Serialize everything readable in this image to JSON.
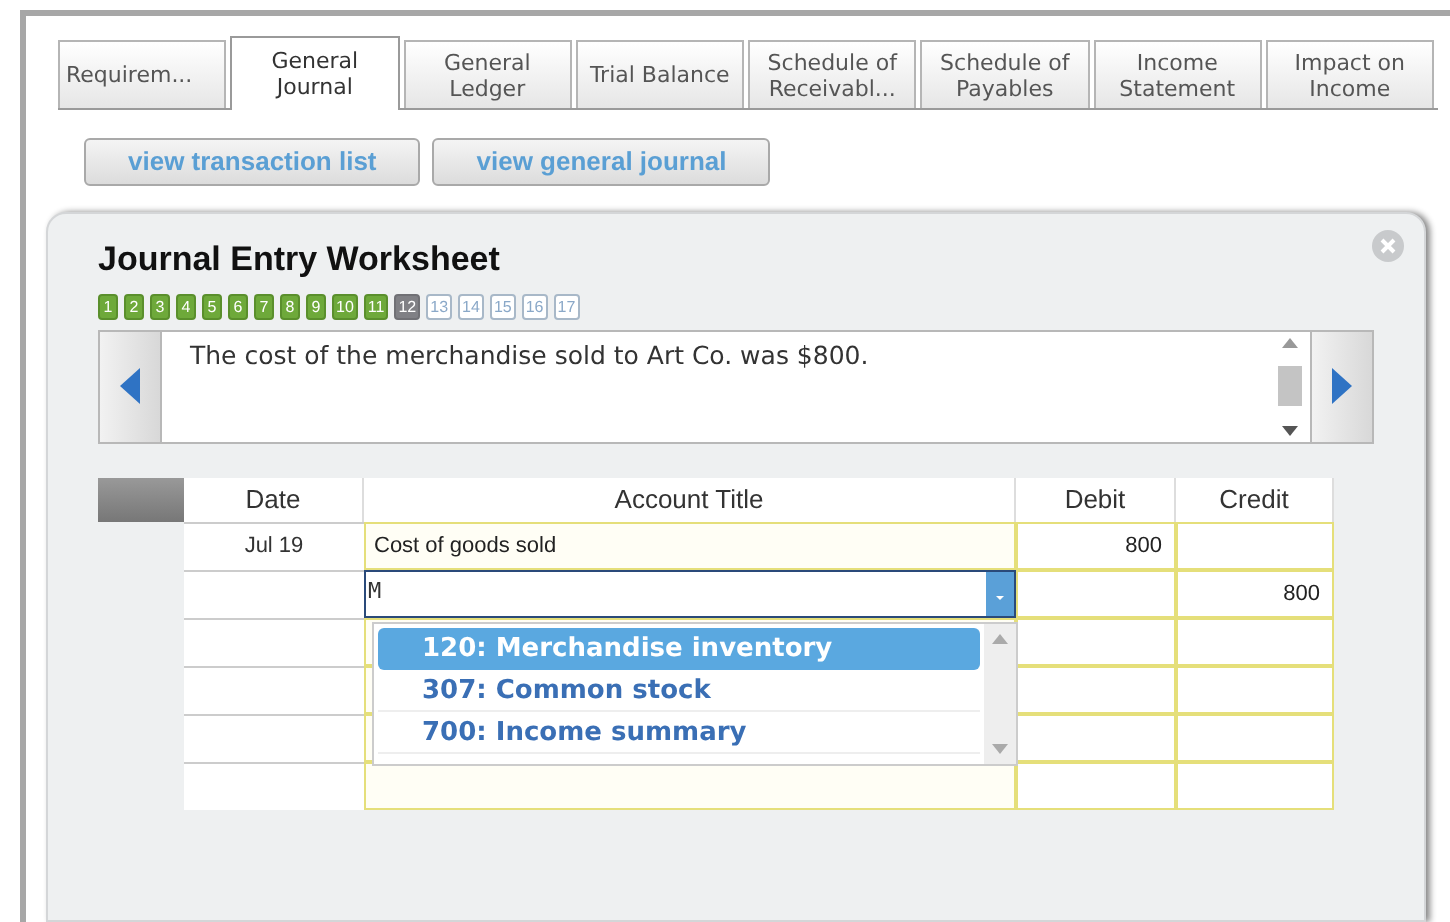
{
  "tabs": [
    {
      "label": "Requirem...",
      "selected": false
    },
    {
      "label": "General Journal",
      "selected": true
    },
    {
      "label": "General Ledger",
      "selected": false
    },
    {
      "label": "Trial Balance",
      "selected": false
    },
    {
      "label": "Schedule of Receivabl...",
      "selected": false
    },
    {
      "label": "Schedule of Payables",
      "selected": false
    },
    {
      "label": "Income Statement",
      "selected": false
    },
    {
      "label": "Impact on Income",
      "selected": false
    }
  ],
  "buttons": [
    "view transaction list",
    "view general journal"
  ],
  "worksheet": {
    "title": "Journal Entry Worksheet",
    "steps": [
      {
        "label": "1",
        "completed": true,
        "selected": false
      },
      {
        "label": "2",
        "completed": true,
        "selected": false
      },
      {
        "label": "3",
        "completed": true,
        "selected": false
      },
      {
        "label": "4",
        "completed": true,
        "selected": false
      },
      {
        "label": "5",
        "completed": true,
        "selected": false
      },
      {
        "label": "6",
        "completed": true,
        "selected": false
      },
      {
        "label": "7",
        "completed": true,
        "selected": false
      },
      {
        "label": "8",
        "completed": true,
        "selected": false
      },
      {
        "label": "9",
        "completed": true,
        "selected": false
      },
      {
        "label": "10",
        "completed": true,
        "selected": false
      },
      {
        "label": "11",
        "completed": true,
        "selected": false
      },
      {
        "label": "12",
        "completed": false,
        "selected": true
      },
      {
        "label": "13",
        "completed": false,
        "selected": false
      },
      {
        "label": "14",
        "completed": false,
        "selected": false
      },
      {
        "label": "15",
        "completed": false,
        "selected": false
      },
      {
        "label": "16",
        "completed": false,
        "selected": false
      },
      {
        "label": "17",
        "completed": false,
        "selected": false
      }
    ],
    "description": "The cost of the merchandise sold to Art Co. was $800.",
    "table": {
      "columns": [
        "Date",
        "Account Title",
        "Debit",
        "Credit"
      ],
      "rows": [
        {
          "date": "Jul 19",
          "account": "Cost of goods sold",
          "debit": "800",
          "credit": ""
        },
        {
          "date": "",
          "account": "M",
          "account_active": true,
          "debit": "",
          "credit": "800"
        },
        {
          "date": "",
          "account": "",
          "debit": "",
          "credit": ""
        },
        {
          "date": "",
          "account": "",
          "debit": "",
          "credit": ""
        },
        {
          "date": "",
          "account": "",
          "debit": "",
          "credit": ""
        },
        {
          "date": "",
          "account": "",
          "debit": "",
          "credit": ""
        }
      ]
    },
    "dropdown": [
      {
        "label": "120: Merchandise inventory",
        "selected": true
      },
      {
        "label": "307: Common stock",
        "selected": false
      },
      {
        "label": "700: Income summary",
        "selected": false
      }
    ]
  }
}
